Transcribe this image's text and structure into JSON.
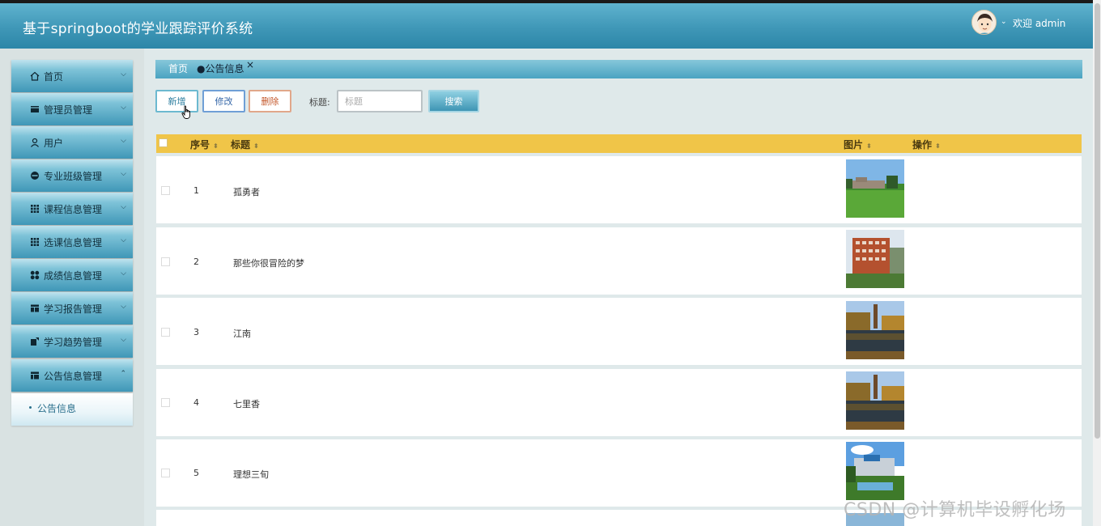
{
  "header": {
    "app_title": "基于springboot的学业跟踪评价系统",
    "welcome": "欢迎 admin",
    "avatar_icon": "user-avatar-icon"
  },
  "sidebar": {
    "items": [
      {
        "label": "首页",
        "icon": "home-icon"
      },
      {
        "label": "管理员管理",
        "icon": "card-icon"
      },
      {
        "label": "用户",
        "icon": "user-icon"
      },
      {
        "label": "专业班级管理",
        "icon": "circle-icon"
      },
      {
        "label": "课程信息管理",
        "icon": "grid-icon"
      },
      {
        "label": "选课信息管理",
        "icon": "grid-icon"
      },
      {
        "label": "成绩信息管理",
        "icon": "dots-icon"
      },
      {
        "label": "学习报告管理",
        "icon": "layout-icon"
      },
      {
        "label": "学习趋势管理",
        "icon": "trend-icon"
      },
      {
        "label": "公告信息管理",
        "icon": "table-icon"
      }
    ],
    "sub_item": "公告信息"
  },
  "tabs": {
    "home": "首页",
    "active": "●公告信息",
    "close": "×"
  },
  "toolbar": {
    "add": "新增",
    "edit": "修改",
    "delete": "删除",
    "title_label": "标题:",
    "search_placeholder": "标题",
    "search": "搜索"
  },
  "table": {
    "headers": {
      "index": "序号",
      "title": "标题",
      "image": "图片",
      "action": "操作"
    },
    "rows": [
      {
        "index": "1",
        "title": "孤勇者"
      },
      {
        "index": "2",
        "title": "那些你很冒险的梦"
      },
      {
        "index": "3",
        "title": "江南"
      },
      {
        "index": "4",
        "title": "七里香"
      },
      {
        "index": "5",
        "title": "理想三旬"
      }
    ]
  },
  "watermark": "CSDN @计算机毕设孵化场"
}
